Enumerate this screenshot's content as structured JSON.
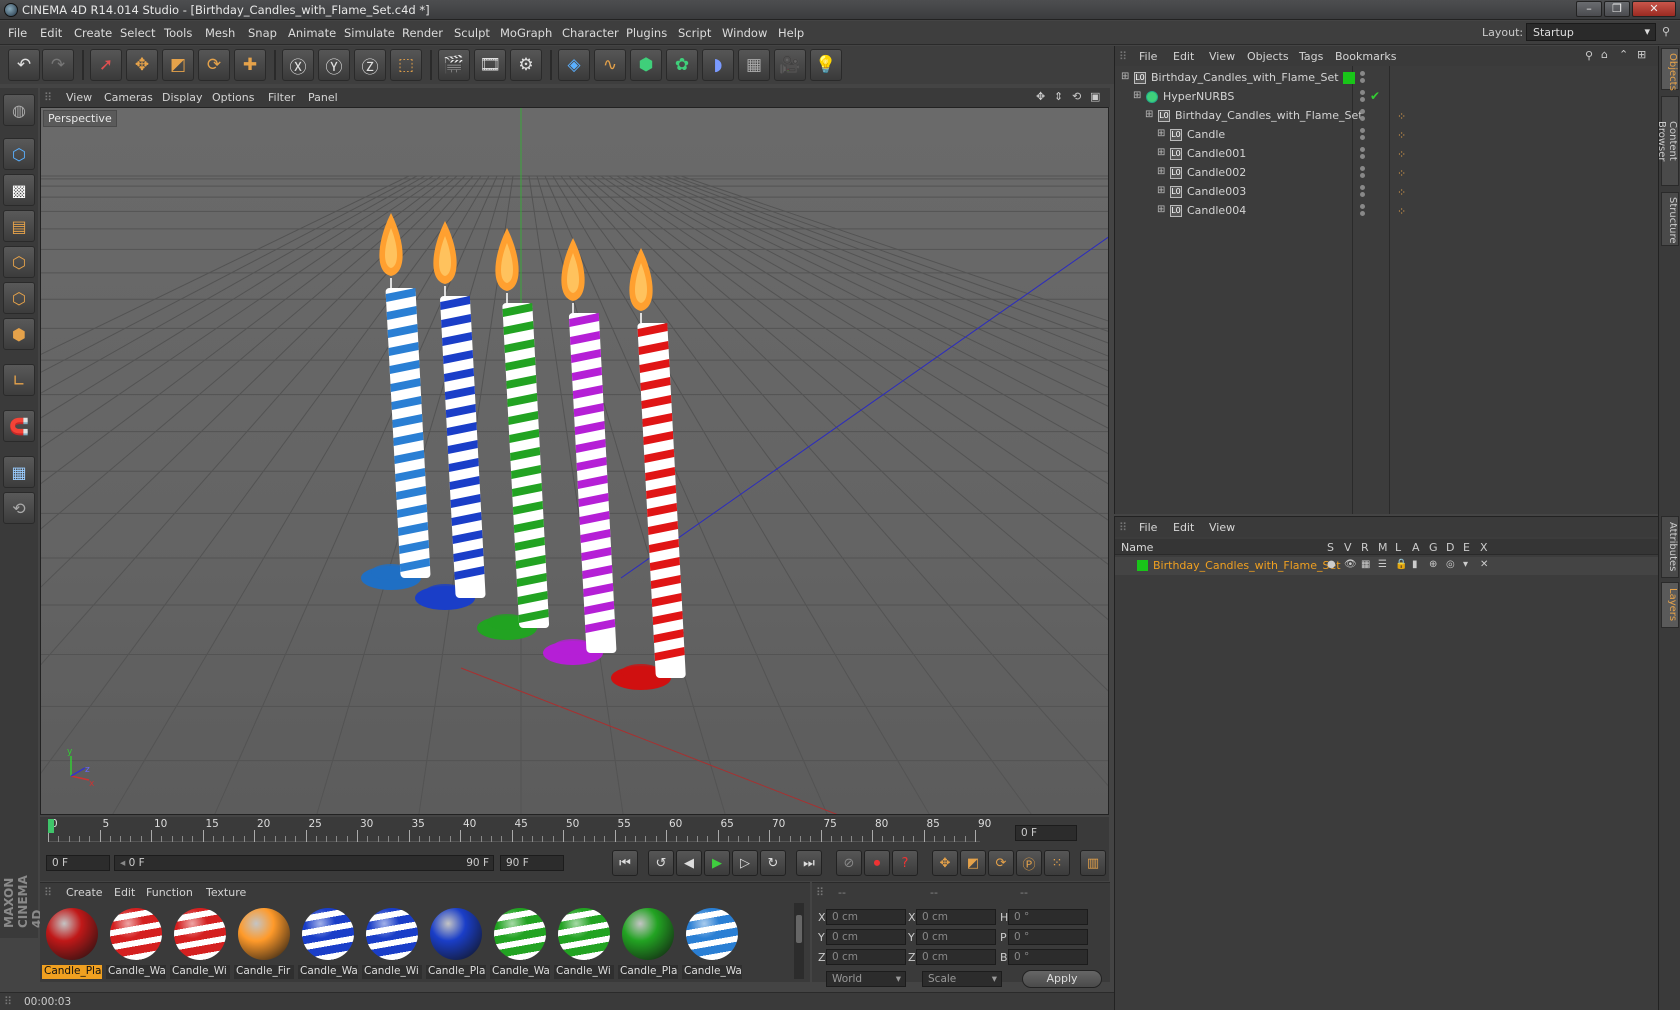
{
  "window": {
    "title": "CINEMA 4D R14.014 Studio - [Birthday_Candles_with_Flame_Set.c4d *]",
    "min": "–",
    "max": "❐",
    "close": "✕"
  },
  "menu": [
    "File",
    "Edit",
    "Create",
    "Select",
    "Tools",
    "Mesh",
    "Snap",
    "Animate",
    "Simulate",
    "Render",
    "Sculpt",
    "MoGraph",
    "Character",
    "Plugins",
    "Script",
    "Window",
    "Help"
  ],
  "layout": {
    "label": "Layout:",
    "value": "Startup"
  },
  "viewport": {
    "menu": [
      "View",
      "Cameras",
      "Display",
      "Options",
      "Filter",
      "Panel"
    ],
    "label": "Perspective",
    "candles": [
      {
        "stripe": "#2a7fd4",
        "wax": "#ffffff",
        "base": "#1f6fc4"
      },
      {
        "stripe": "#1a3ec8",
        "wax": "#ffffff",
        "base": "#1a3ec8"
      },
      {
        "stripe": "#22a322",
        "wax": "#ffffff",
        "base": "#22a322"
      },
      {
        "stripe": "#b51fd6",
        "wax": "#ffffff",
        "base": "#b51fd6"
      },
      {
        "stripe": "#e01515",
        "wax": "#ffffff",
        "base": "#d01010"
      }
    ]
  },
  "timeline": {
    "ticks": [
      "0",
      "5",
      "10",
      "15",
      "20",
      "25",
      "30",
      "35",
      "40",
      "45",
      "50",
      "55",
      "60",
      "65",
      "70",
      "75",
      "80",
      "85",
      "90"
    ],
    "current": "0 F"
  },
  "transport": {
    "start": "0 F",
    "range_start": "0 F",
    "range_end": "90 F",
    "end": "90 F"
  },
  "materials": {
    "menu": [
      "Create",
      "Edit",
      "Function",
      "Texture"
    ],
    "items": [
      {
        "label": "Candle_Pla",
        "color": "#c01818",
        "stripe": "",
        "selected": true
      },
      {
        "label": "Candle_Wa",
        "color": "#d42020",
        "stripe": "#ffffff",
        "selected": false
      },
      {
        "label": "Candle_Wi",
        "color": "#d42020",
        "stripe": "#ffffff",
        "selected": false
      },
      {
        "label": "Candle_Fir",
        "color": "#ff9a2a",
        "stripe": "",
        "selected": false
      },
      {
        "label": "Candle_Wa",
        "color": "#1a3ec8",
        "stripe": "#ffffff",
        "selected": false
      },
      {
        "label": "Candle_Wi",
        "color": "#1a3ec8",
        "stripe": "#ffffff",
        "selected": false
      },
      {
        "label": "Candle_Pla",
        "color": "#1a3ec8",
        "stripe": "",
        "selected": false
      },
      {
        "label": "Candle_Wa",
        "color": "#22a322",
        "stripe": "#ffffff",
        "selected": false
      },
      {
        "label": "Candle_Wi",
        "color": "#22a322",
        "stripe": "#ffffff",
        "selected": false
      },
      {
        "label": "Candle_Pla",
        "color": "#22a322",
        "stripe": "",
        "selected": false
      },
      {
        "label": "Candle_Wa",
        "color": "#2a7fd4",
        "stripe": "#ffffff",
        "selected": false
      }
    ]
  },
  "coords": {
    "headers": [
      "--",
      "--",
      "--"
    ],
    "rows": [
      {
        "a": "X",
        "av": "0 cm",
        "b": "X",
        "bv": "0 cm",
        "c": "H",
        "cv": "0 °"
      },
      {
        "a": "Y",
        "av": "0 cm",
        "b": "Y",
        "bv": "0 cm",
        "c": "P",
        "cv": "0 °"
      },
      {
        "a": "Z",
        "av": "0 cm",
        "b": "Z",
        "bv": "0 cm",
        "c": "B",
        "cv": "0 °"
      }
    ],
    "mode": "World",
    "scale": "Scale",
    "apply": "Apply"
  },
  "status": "00:00:03",
  "objects": {
    "menu": [
      "File",
      "Edit",
      "View",
      "Objects",
      "Tags",
      "Bookmarks"
    ],
    "rows": [
      {
        "name": "Birthday_Candles_with_Flame_Set",
        "level": 0
      },
      {
        "name": "HyperNURBS",
        "level": 1
      },
      {
        "name": "Birthday_Candles_with_Flame_Set",
        "level": 2
      },
      {
        "name": "Candle",
        "level": 3
      },
      {
        "name": "Candle001",
        "level": 3
      },
      {
        "name": "Candle002",
        "level": 3
      },
      {
        "name": "Candle003",
        "level": 3
      },
      {
        "name": "Candle004",
        "level": 3
      }
    ]
  },
  "layers": {
    "menu": [
      "File",
      "Edit",
      "View"
    ],
    "header_name": "Name",
    "cols": [
      "S",
      "V",
      "R",
      "M",
      "L",
      "A",
      "G",
      "D",
      "E",
      "X"
    ],
    "rows": [
      {
        "name": "Birthday_Candles_with_Flame_Set",
        "color": "#19c519"
      }
    ]
  },
  "sidetabs": [
    "Objects",
    "Content Browser",
    "Structure",
    "Attributes",
    "Layers"
  ],
  "maxon": "MAXON CINEMA 4D"
}
